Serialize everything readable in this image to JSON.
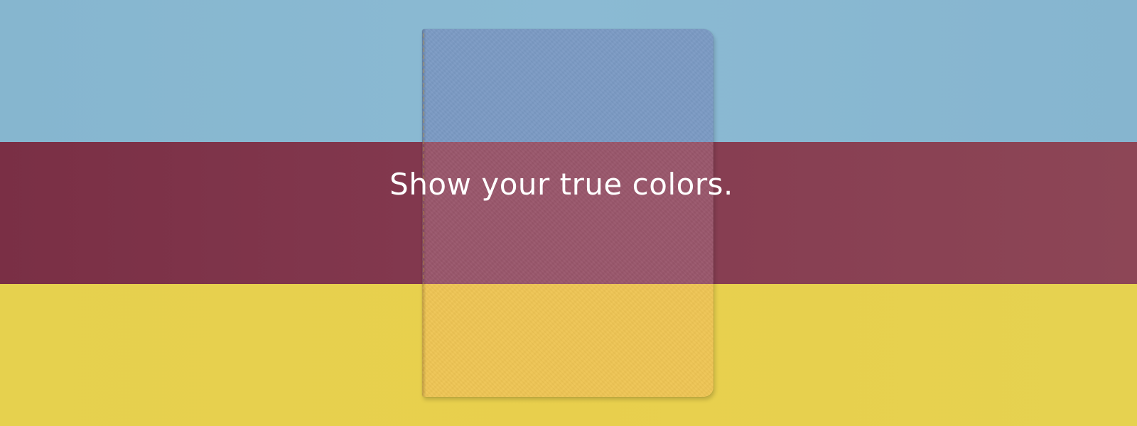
{
  "headline": "Show your true colors.",
  "colors": {
    "stripe_top": "#8ab8d1",
    "stripe_middle": "#843a50",
    "stripe_bottom": "#e8cf4d",
    "notebook_top": "#7b9ac4",
    "notebook_middle": "#99566b",
    "notebook_bottom": "#efc554",
    "text": "#ffffff"
  }
}
